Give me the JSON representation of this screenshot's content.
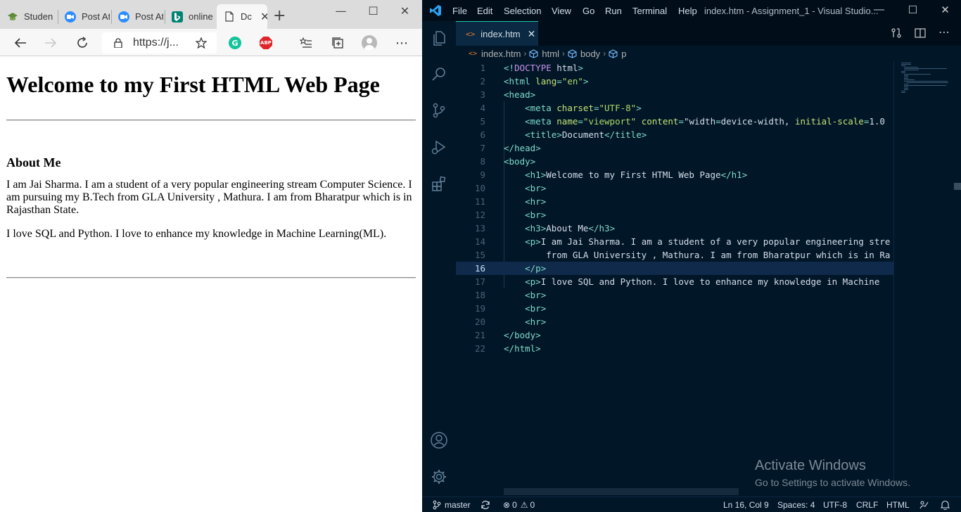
{
  "browser": {
    "tabs": [
      {
        "label": "Studen",
        "favicon": "graduation-cap-icon",
        "color": "#5e8a3a"
      },
      {
        "label": "Post At",
        "favicon": "zoom-icon",
        "color": "#2d8cff"
      },
      {
        "label": "Post At",
        "favicon": "zoom-icon",
        "color": "#2d8cff"
      },
      {
        "label": "online",
        "favicon": "bing-icon",
        "color": "#008373"
      },
      {
        "label": "Dc",
        "favicon": "page-icon",
        "color": "#555555"
      }
    ],
    "new_tab": "+",
    "url": "https://j...",
    "page": {
      "heading": "Welcome to my First HTML Web Page",
      "about_heading": "About Me",
      "para1": "I am Jai Sharma. I am a student of a very popular engineering stream Computer Science. I am pursuing my B.Tech from GLA University , Mathura. I am from Bharatpur which is in Rajasthan State.",
      "para2": "I love SQL and Python. I love to enhance my knowledge in Machine Learning(ML)."
    }
  },
  "vscode": {
    "menu": [
      "File",
      "Edit",
      "Selection",
      "View",
      "Go",
      "Run",
      "Terminal",
      "Help"
    ],
    "window_title": "index.htm - Assignment_1 - Visual Studio...",
    "tab_label": "index.htm",
    "breadcrumb": [
      "index.htm",
      "html",
      "body",
      "p"
    ],
    "code_lines": [
      {
        "n": "1",
        "text": "<!DOCTYPE html>"
      },
      {
        "n": "2",
        "text": "<html lang=\"en\">"
      },
      {
        "n": "3",
        "text": "<head>"
      },
      {
        "n": "4",
        "text": "    <meta charset=\"UTF-8\">"
      },
      {
        "n": "5",
        "text": "    <meta name=\"viewport\" content=\"width=device-width, initial-scale=1.0"
      },
      {
        "n": "6",
        "text": "    <title>Document</title>"
      },
      {
        "n": "7",
        "text": "</head>"
      },
      {
        "n": "8",
        "text": "<body>"
      },
      {
        "n": "9",
        "text": "    <h1>Welcome to my First HTML Web Page</h1>"
      },
      {
        "n": "10",
        "text": "    <br>"
      },
      {
        "n": "11",
        "text": "    <hr>"
      },
      {
        "n": "12",
        "text": "    <br>"
      },
      {
        "n": "13",
        "text": "    <h3>About Me</h3>"
      },
      {
        "n": "14",
        "text": "    <p>I am Jai Sharma. I am a student of a very popular engineering stre"
      },
      {
        "n": "15",
        "text": "        from GLA University , Mathura. I am from Bharatpur which is in Ra"
      },
      {
        "n": "16",
        "text": "    </p>"
      },
      {
        "n": "17",
        "text": "    <p>I love SQL and Python. I love to enhance my knowledge in Machine"
      },
      {
        "n": "18",
        "text": "    <br>"
      },
      {
        "n": "19",
        "text": "    <br>"
      },
      {
        "n": "20",
        "text": "    <hr>"
      },
      {
        "n": "21",
        "text": "</body>"
      },
      {
        "n": "22",
        "text": "</html>"
      }
    ],
    "current_line": "16",
    "activate": {
      "title": "Activate Windows",
      "subtitle": "Go to Settings to activate Windows."
    },
    "status": {
      "branch": "master",
      "problems": "0",
      "warnings": "0",
      "position": "Ln 16, Col 9",
      "spaces": "Spaces: 4",
      "encoding": "UTF-8",
      "eol": "CRLF",
      "language": "HTML"
    },
    "accent": "#21c7a8"
  }
}
